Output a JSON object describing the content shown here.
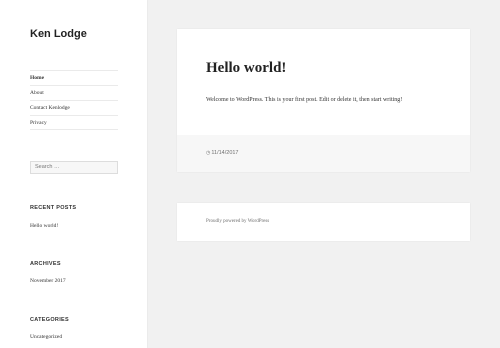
{
  "site": {
    "title": "Ken Lodge"
  },
  "nav": {
    "items": [
      {
        "label": "Home"
      },
      {
        "label": "About"
      },
      {
        "label": "Contact Kenlodge"
      },
      {
        "label": "Privacy"
      }
    ]
  },
  "search": {
    "placeholder": "Search …"
  },
  "widgets": {
    "recent_posts": {
      "title": "RECENT POSTS",
      "items": [
        "Hello world!"
      ]
    },
    "archives": {
      "title": "ARCHIVES",
      "items": [
        "November 2017"
      ]
    },
    "categories": {
      "title": "CATEGORIES",
      "items": [
        "Uncategorized"
      ]
    }
  },
  "post": {
    "title": "Hello world!",
    "body": "Welcome to WordPress. This is your first post. Edit or delete it, then start writing!",
    "date": "11/14/2017",
    "date_icon": "clock-icon"
  },
  "footer": {
    "credit": "Proudly powered by WordPress"
  }
}
